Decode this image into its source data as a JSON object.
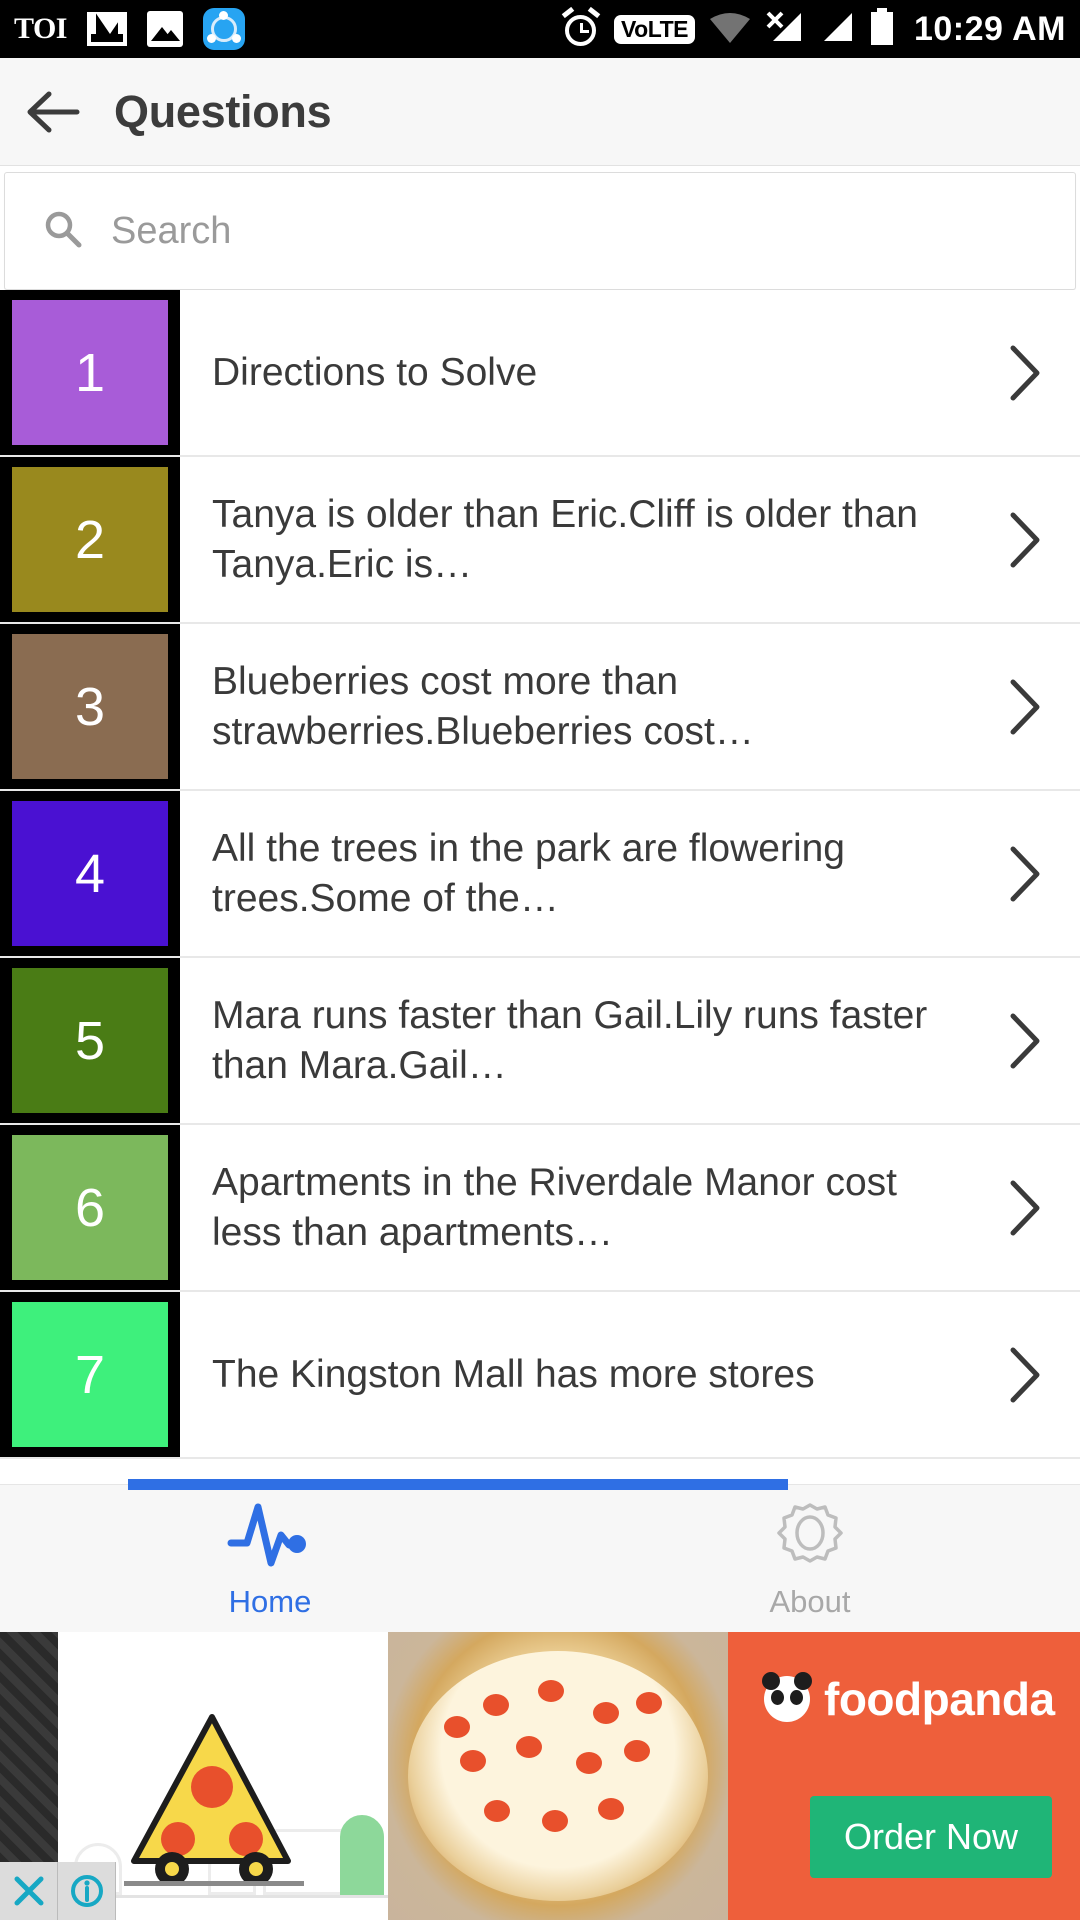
{
  "status_bar": {
    "time": "10:29 AM",
    "volte_label": "VoLTE",
    "app_icons": [
      "toi-icon",
      "gmail-icon",
      "photos-icon",
      "shareit-icon"
    ],
    "system_icons": [
      "alarm-icon",
      "volte-icon",
      "wifi-icon",
      "signal-no-service-icon",
      "signal-icon",
      "battery-icon"
    ],
    "toi_label": "TOI"
  },
  "appbar": {
    "back_icon": "back-arrow-icon",
    "title": "Questions"
  },
  "search": {
    "placeholder": "Search",
    "value": "",
    "icon": "search-icon"
  },
  "list": {
    "items": [
      {
        "number": "1",
        "color": "#a85cd8",
        "title": "Directions to Solve"
      },
      {
        "number": "2",
        "color": "#99891e",
        "title": "Tanya is older than Eric.Cliff is older than Tanya.Eric is…"
      },
      {
        "number": "3",
        "color": "#8a6c51",
        "title": "Blueberries cost more than strawberries.Blueberries cost…"
      },
      {
        "number": "4",
        "color": "#4a11d2",
        "title": "All the trees in the park are flowering trees.Some of the…"
      },
      {
        "number": "5",
        "color": "#4a7c15",
        "title": "Mara runs faster than Gail.Lily runs faster than Mara.Gail…"
      },
      {
        "number": "6",
        "color": "#7cb85c",
        "title": "Apartments in the Riverdale Manor cost less than apartments…"
      },
      {
        "number": "7",
        "color": "#3ef07c",
        "title": "The Kingston Mall has more stores"
      }
    ],
    "chevron_icon": "chevron-right-icon"
  },
  "bottom_nav": {
    "items": [
      {
        "label": "Home",
        "icon": "pulse-icon",
        "active": true
      },
      {
        "label": "About",
        "icon": "gear-icon",
        "active": false
      }
    ],
    "accent_color": "#2f6fe4",
    "inactive_color": "#a8a8a8"
  },
  "ad": {
    "brand": "foodpanda",
    "cta": "Order Now",
    "close_icon": "close-icon",
    "info_icon": "info-icon",
    "brand_color": "#ee5f3b",
    "cta_color": "#1fb577"
  }
}
